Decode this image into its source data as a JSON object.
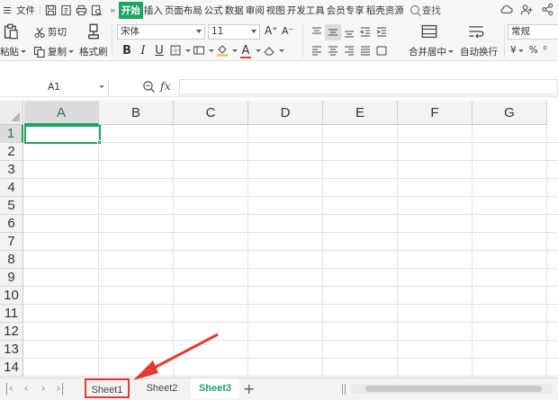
{
  "menubar": {
    "file_label": "文件",
    "tabs": [
      "开始",
      "插入",
      "页面布局",
      "公式",
      "数据",
      "审阅",
      "视图",
      "开发工具",
      "会员专享",
      "稻壳资源"
    ],
    "active_tab": "开始",
    "search_label": "查找",
    "more_symbol": "»"
  },
  "ribbon": {
    "paste_label": "粘贴",
    "cut_label": "剪切",
    "copy_label": "复制",
    "format_painter_label": "格式刷",
    "font_name": "宋体",
    "font_size": "11",
    "font_grow": "A⁺",
    "font_shrink": "A⁻",
    "bold": "B",
    "italic": "I",
    "underline": "U",
    "font_color_glyph": "A",
    "merge_center_label": "合并居中",
    "wrap_text_label": "自动换行",
    "number_format": "常规",
    "currency_symbol": "¥",
    "percent_symbol": "%",
    "thousands_symbol": "⁰"
  },
  "formula_bar": {
    "name_box": "A1",
    "fx_label": "fx",
    "formula": ""
  },
  "grid": {
    "columns": [
      "A",
      "B",
      "C",
      "D",
      "E",
      "F",
      "G"
    ],
    "rows": [
      "1",
      "2",
      "3",
      "4",
      "5",
      "6",
      "7",
      "8",
      "9",
      "10",
      "11",
      "12",
      "13",
      "14"
    ],
    "selected_cell": "A1"
  },
  "sheets": {
    "tabs": [
      "Sheet1",
      "Sheet2",
      "Sheet3"
    ],
    "active": "Sheet3",
    "highlighted": "Sheet1",
    "add_symbol": "+"
  },
  "colors": {
    "accent_green": "#1da462",
    "annotation_red": "#e53935"
  }
}
